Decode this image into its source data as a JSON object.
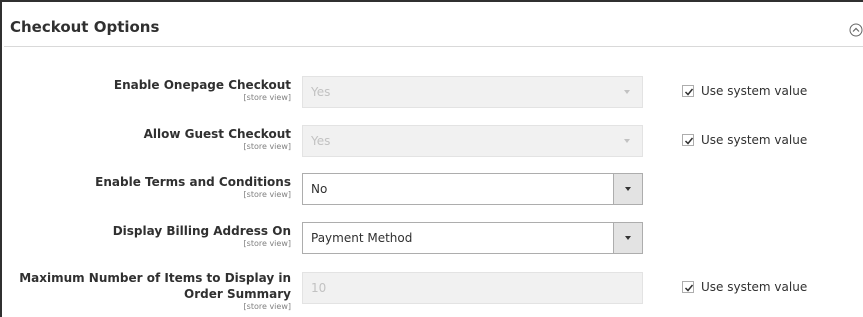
{
  "section": {
    "title": "Checkout Options"
  },
  "fields": [
    {
      "label": "Enable Onepage Checkout",
      "scope": "[store view]",
      "value": "Yes",
      "system_value_label": "Use system value",
      "use_system_value": true
    },
    {
      "label": "Allow Guest Checkout",
      "scope": "[store view]",
      "value": "Yes",
      "system_value_label": "Use system value",
      "use_system_value": true
    },
    {
      "label": "Enable Terms and Conditions",
      "scope": "[store view]",
      "value": "No"
    },
    {
      "label": "Display Billing Address On",
      "scope": "[store view]",
      "value": "Payment Method"
    },
    {
      "label_line1": "Maximum Number of Items to Display in",
      "label_line2": "Order Summary",
      "scope": "[store view]",
      "value": "10",
      "system_value_label": "Use system value",
      "use_system_value": true
    }
  ],
  "colors": {
    "text": "#303030",
    "disabled_text": "#c2c2c2",
    "disabled_bg": "#f1f1f1",
    "border": "#adadad",
    "muted": "#808080"
  }
}
